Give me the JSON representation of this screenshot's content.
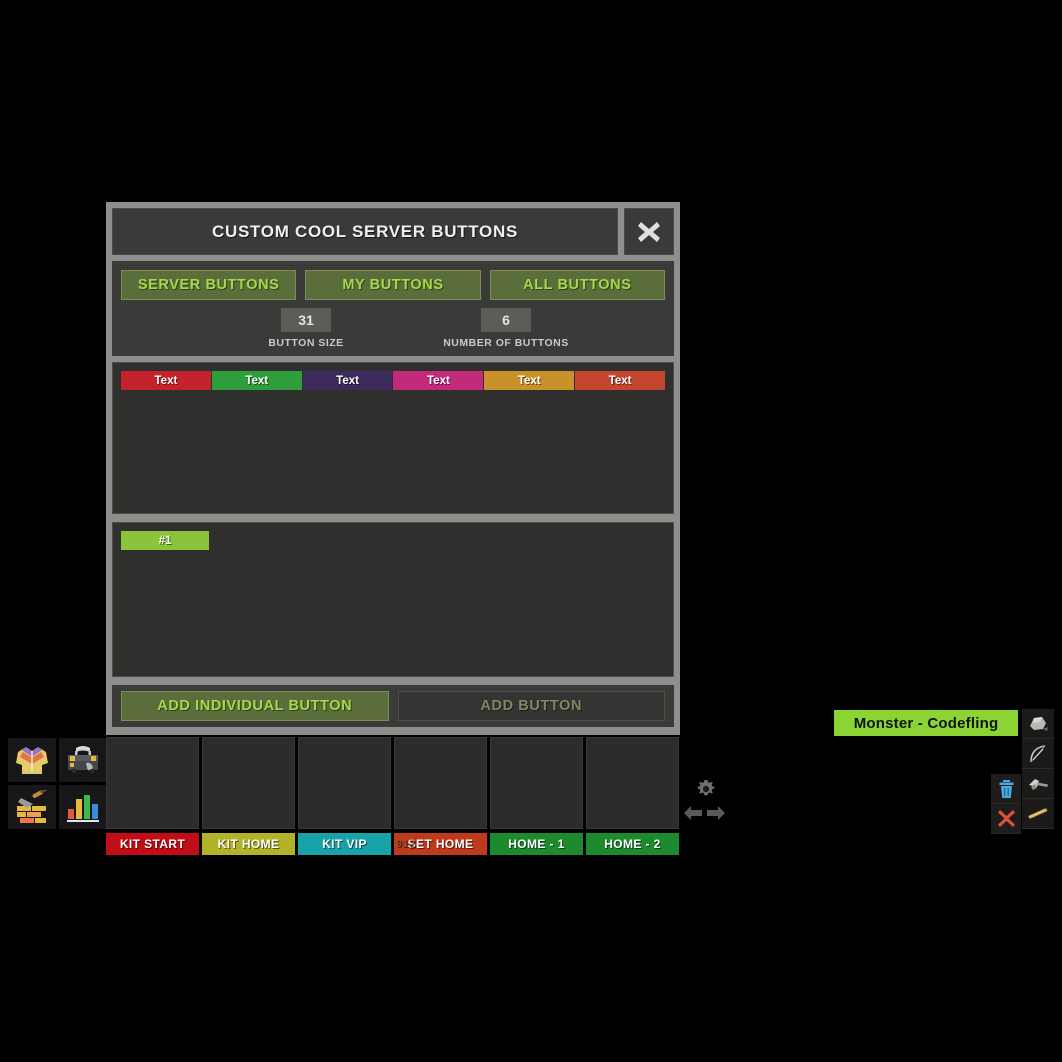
{
  "dialog": {
    "title": "CUSTOM COOL SERVER BUTTONS",
    "close_icon": "close-icon",
    "tabs": [
      {
        "label": "SERVER BUTTONS",
        "active": true
      },
      {
        "label": "MY BUTTONS",
        "active": false
      },
      {
        "label": "ALL BUTTONS",
        "active": false
      }
    ],
    "fields": [
      {
        "value": "31",
        "label": "BUTTON SIZE"
      },
      {
        "value": "6",
        "label": "NUMBER OF BUTTONS"
      }
    ],
    "color_buttons": [
      {
        "label": "Text",
        "color": "#c4232b"
      },
      {
        "label": "Text",
        "color": "#2e9e3a"
      },
      {
        "label": "Text",
        "color": "#3c2a5c"
      },
      {
        "label": "Text",
        "color": "#c42a7c"
      },
      {
        "label": "Text",
        "color": "#c9912a"
      },
      {
        "label": "Text",
        "color": "#c4462e"
      }
    ],
    "numbered_buttons": [
      {
        "label": "#1",
        "color": "#8bc43a"
      }
    ],
    "actions": [
      {
        "label": "ADD INDIVIDUAL BUTTON",
        "style": "primary"
      },
      {
        "label": "ADD BUTTON",
        "style": "secondary"
      }
    ]
  },
  "hud": {
    "slots": [
      {
        "label": "KIT START",
        "color": "#c10d17",
        "ghost": ""
      },
      {
        "label": "KIT HOME",
        "color": "#b3b32a",
        "ghost": ""
      },
      {
        "label": "KIT VIP",
        "color": "#17a3a8",
        "ghost": ""
      },
      {
        "label": "SET HOME",
        "color": "#bf3a1c",
        "ghost": "912"
      },
      {
        "label": "HOME - 1",
        "color": "#1d8a2e",
        "ghost": ""
      },
      {
        "label": "HOME - 2",
        "color": "#1d8a2e",
        "ghost": ""
      }
    ]
  },
  "left_icons": [
    {
      "name": "jacket-icon"
    },
    {
      "name": "toolbox-icon"
    },
    {
      "name": "bricks-trowel-icon"
    },
    {
      "name": "bar-chart-icon"
    }
  ],
  "center_controls": {
    "gear_icon": "gear-icon",
    "arrow_left_icon": "arrow-left-icon",
    "arrow_right_icon": "arrow-right-icon"
  },
  "player": {
    "name_tag": "Monster - Codefling",
    "name_tag_color": "#8bd434"
  },
  "item_strip": [
    {
      "name": "rock-icon"
    },
    {
      "name": "bow-icon"
    },
    {
      "name": "hammer-icon"
    },
    {
      "name": "stick-icon"
    }
  ],
  "right_extra": [
    {
      "name": "trash-icon"
    },
    {
      "name": "red-x-icon"
    }
  ]
}
